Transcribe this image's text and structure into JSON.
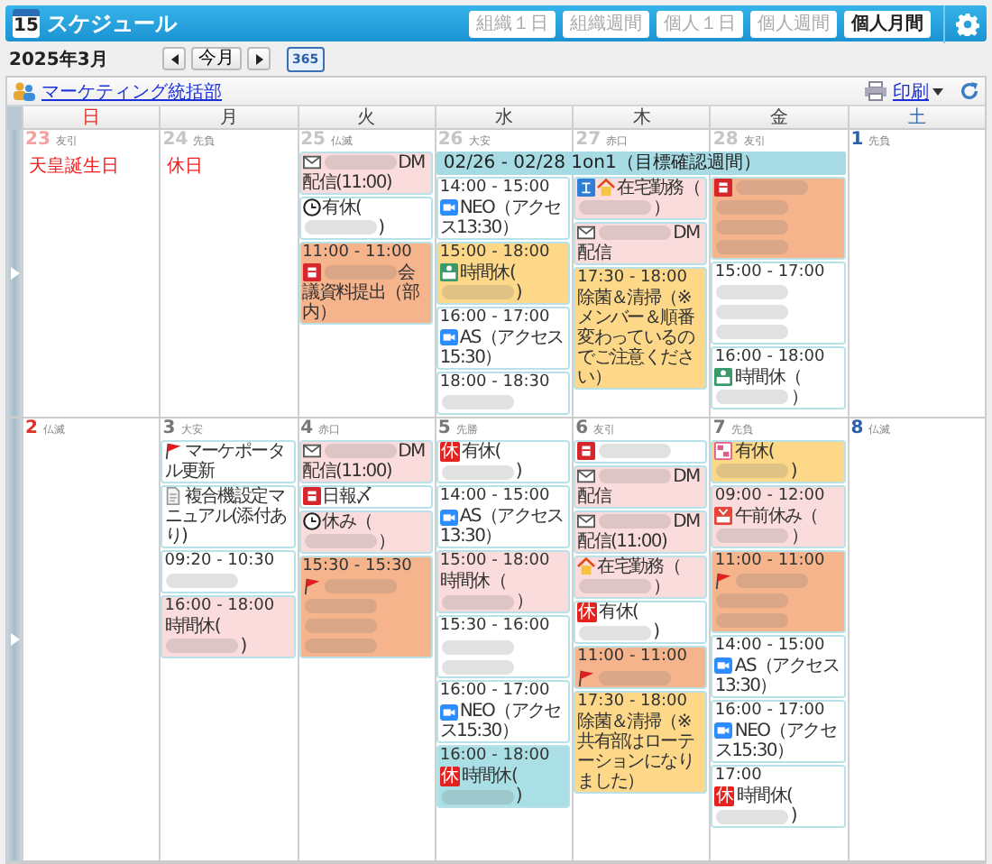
{
  "header": {
    "app_icon_day": "15",
    "title": "スケジュール",
    "views": [
      {
        "label": "組織１日",
        "selected": false
      },
      {
        "label": "組織週間",
        "selected": false
      },
      {
        "label": "個人１日",
        "selected": false
      },
      {
        "label": "個人週間",
        "selected": false
      },
      {
        "label": "個人月間",
        "selected": true
      }
    ]
  },
  "nav": {
    "month": "2025年3月",
    "today": "今月",
    "year_button": "365"
  },
  "group": {
    "name": "マーケティング統括部",
    "print": "印刷"
  },
  "weekdays": [
    {
      "label": "日",
      "kind": "sunday"
    },
    {
      "label": "月",
      "kind": "weekday"
    },
    {
      "label": "火",
      "kind": "weekday"
    },
    {
      "label": "水",
      "kind": "weekday"
    },
    {
      "label": "木",
      "kind": "weekday"
    },
    {
      "label": "金",
      "kind": "weekday"
    },
    {
      "label": "土",
      "kind": "saturday"
    }
  ],
  "weeks": [
    {
      "banner": "02/26 - 02/28 1on1（目標確認週間）",
      "days": [
        {
          "date": "23",
          "rokuyo": "友引",
          "kind": "sunday",
          "muted": true,
          "holiday": "天皇誕生日"
        },
        {
          "date": "24",
          "rokuyo": "先負",
          "kind": "weekday",
          "muted": true,
          "holiday": "休日"
        },
        {
          "date": "25",
          "rokuyo": "仏滅",
          "kind": "weekday",
          "muted": true,
          "events": [
            {
              "kind": "mail",
              "color": "#fbdcdc",
              "parts": [
                {
                  "kind": "blur"
                },
                {
                  "kind": "text",
                  "text": "DM配信(11:00)"
                }
              ]
            },
            {
              "kind": "leave",
              "color": "#ffffff",
              "parts": [
                {
                  "kind": "text",
                  "text": "有休("
                },
                {
                  "kind": "blur"
                },
                {
                  "kind": "text",
                  "text": ")"
                }
              ]
            },
            {
              "kind": "task",
              "color": "#f5b48c",
              "time": "11:00 - 11:00",
              "parts": [
                {
                  "kind": "blur"
                },
                {
                  "kind": "text",
                  "text": "会議資料提出（部内）"
                }
              ]
            }
          ]
        },
        {
          "date": "26",
          "rokuyo": "大安",
          "kind": "weekday",
          "muted": true,
          "in_banner": true,
          "events": [
            {
              "kind": "video",
              "color": "#ffffff",
              "time": "14:00 - 15:00",
              "parts": [
                {
                  "kind": "text",
                  "text": "NEO（アクセス13:30）"
                }
              ]
            },
            {
              "kind": "timecard",
              "color": "#fdd889",
              "time": "15:00 - 18:00",
              "parts": [
                {
                  "kind": "text",
                  "text": "時間休("
                },
                {
                  "kind": "blur"
                },
                {
                  "kind": "text",
                  "text": ")"
                }
              ]
            },
            {
              "kind": "video",
              "color": "#ffffff",
              "time": "16:00 - 17:00",
              "parts": [
                {
                  "kind": "text",
                  "text": "AS（アクセス15:30）"
                }
              ]
            },
            {
              "kind": "plain",
              "color": "#ffffff",
              "time": "18:00 - 18:30",
              "parts": [
                {
                  "kind": "blur"
                }
              ]
            }
          ]
        },
        {
          "date": "27",
          "rokuyo": "赤口",
          "kind": "weekday",
          "muted": true,
          "in_banner": true,
          "events": [
            {
              "kind": "remote",
              "color": "#fbdcdc",
              "parts": [
                {
                  "kind": "text",
                  "text": "在宅勤務（"
                },
                {
                  "kind": "blur"
                },
                {
                  "kind": "text",
                  "text": "）"
                }
              ]
            },
            {
              "kind": "mail",
              "color": "#fbdcdc",
              "parts": [
                {
                  "kind": "blur"
                },
                {
                  "kind": "text",
                  "text": "DM配信"
                }
              ]
            },
            {
              "kind": "plain",
              "color": "#fdd889",
              "time": "17:30 - 18:00",
              "parts": [
                {
                  "kind": "text",
                  "text": "除菌＆清掃（※メンバー＆順番変わっているのでご注意ください）"
                }
              ]
            }
          ]
        },
        {
          "date": "28",
          "rokuyo": "友引",
          "kind": "weekday",
          "muted": true,
          "in_banner": true,
          "events": [
            {
              "kind": "task",
              "color": "#f5b48c",
              "parts": [
                {
                  "kind": "blur"
                },
                {
                  "kind": "blur"
                },
                {
                  "kind": "blur"
                },
                {
                  "kind": "blur"
                }
              ]
            },
            {
              "kind": "plain",
              "color": "#ffffff",
              "time": "15:00 - 17:00",
              "parts": [
                {
                  "kind": "blur"
                },
                {
                  "kind": "blur"
                },
                {
                  "kind": "blur"
                }
              ]
            },
            {
              "kind": "timecard",
              "color": "#ffffff",
              "time": "16:00 - 18:00",
              "parts": [
                {
                  "kind": "text",
                  "text": "時間休（"
                },
                {
                  "kind": "blur"
                },
                {
                  "kind": "text",
                  "text": "）"
                }
              ]
            }
          ]
        },
        {
          "date": "1",
          "rokuyo": "先負",
          "kind": "saturday",
          "muted": false
        }
      ]
    },
    {
      "days": [
        {
          "date": "2",
          "rokuyo": "仏滅",
          "kind": "sunday",
          "muted": false
        },
        {
          "date": "3",
          "rokuyo": "大安",
          "kind": "weekday",
          "muted": false,
          "events": [
            {
              "kind": "flag",
              "color": "#ffffff",
              "parts": [
                {
                  "kind": "text",
                  "text": "マーケポータル更新"
                }
              ]
            },
            {
              "kind": "document",
              "color": "#ffffff",
              "parts": [
                {
                  "kind": "text",
                  "text": "複合機設定マニュアル(添付あり)"
                }
              ]
            },
            {
              "kind": "plain",
              "color": "#ffffff",
              "time": "09:20 - 10:30",
              "parts": [
                {
                  "kind": "blur"
                }
              ]
            },
            {
              "kind": "plain",
              "color": "#fbdcdc",
              "time": "16:00 - 18:00",
              "parts": [
                {
                  "kind": "text",
                  "text": "時間休("
                },
                {
                  "kind": "blur"
                },
                {
                  "kind": "text",
                  "text": ")"
                }
              ]
            }
          ]
        },
        {
          "date": "4",
          "rokuyo": "赤口",
          "kind": "weekday",
          "muted": false,
          "events": [
            {
              "kind": "mail",
              "color": "#fbdcdc",
              "parts": [
                {
                  "kind": "blur"
                },
                {
                  "kind": "text",
                  "text": "DM配信(11:00)"
                }
              ]
            },
            {
              "kind": "task",
              "color": "#ffffff",
              "parts": [
                {
                  "kind": "text",
                  "text": "日報〆"
                }
              ]
            },
            {
              "kind": "leave",
              "color": "#fbdcdc",
              "parts": [
                {
                  "kind": "text",
                  "text": "休み（"
                },
                {
                  "kind": "blur"
                },
                {
                  "kind": "text",
                  "text": "）"
                }
              ]
            },
            {
              "kind": "flag",
              "color": "#f5b48c",
              "time": "15:30 - 15:30",
              "parts": [
                {
                  "kind": "blur"
                },
                {
                  "kind": "blur"
                },
                {
                  "kind": "blur"
                },
                {
                  "kind": "blur"
                }
              ]
            }
          ]
        },
        {
          "date": "5",
          "rokuyo": "先勝",
          "kind": "weekday",
          "muted": false,
          "events": [
            {
              "kind": "plain",
              "color": "#ffffff",
              "badge": "休",
              "parts": [
                {
                  "kind": "text",
                  "text": "有休("
                },
                {
                  "kind": "blur"
                },
                {
                  "kind": "text",
                  "text": ")"
                }
              ]
            },
            {
              "kind": "video",
              "color": "#ffffff",
              "time": "14:00 - 15:00",
              "parts": [
                {
                  "kind": "text",
                  "text": "AS（アクセス13:30）"
                }
              ]
            },
            {
              "kind": "plain",
              "color": "#fbdcdc",
              "time": "15:00 - 18:00",
              "parts": [
                {
                  "kind": "text",
                  "text": "時間休（"
                },
                {
                  "kind": "blur"
                },
                {
                  "kind": "text",
                  "text": "）"
                }
              ]
            },
            {
              "kind": "plain",
              "color": "#ffffff",
              "time": "15:30 - 16:00",
              "parts": [
                {
                  "kind": "blur"
                },
                {
                  "kind": "blur"
                }
              ]
            },
            {
              "kind": "video",
              "color": "#ffffff",
              "time": "16:00 - 17:00",
              "parts": [
                {
                  "kind": "text",
                  "text": "NEO（アクセス15:30）"
                }
              ]
            },
            {
              "kind": "plain",
              "color": "#a9dfe5",
              "time": "16:00 - 18:00",
              "badge": "休",
              "parts": [
                {
                  "kind": "text",
                  "text": "時間休("
                },
                {
                  "kind": "blur"
                },
                {
                  "kind": "text",
                  "text": ")"
                }
              ]
            }
          ]
        },
        {
          "date": "6",
          "rokuyo": "友引",
          "kind": "weekday",
          "muted": false,
          "events": [
            {
              "kind": "task",
              "color": "#ffffff",
              "parts": [
                {
                  "kind": "blur"
                }
              ]
            },
            {
              "kind": "mail",
              "color": "#fbdcdc",
              "parts": [
                {
                  "kind": "blur"
                },
                {
                  "kind": "text",
                  "text": "DM配信"
                }
              ]
            },
            {
              "kind": "mail",
              "color": "#fbdcdc",
              "parts": [
                {
                  "kind": "blur"
                },
                {
                  "kind": "text",
                  "text": "DM配信(11:00)"
                }
              ]
            },
            {
              "kind": "home",
              "color": "#fbdcdc",
              "parts": [
                {
                  "kind": "text",
                  "text": "在宅勤務（"
                },
                {
                  "kind": "blur"
                },
                {
                  "kind": "text",
                  "text": "）"
                }
              ]
            },
            {
              "kind": "plain",
              "color": "#ffffff",
              "badge": "休",
              "parts": [
                {
                  "kind": "text",
                  "text": "有休("
                },
                {
                  "kind": "blur"
                },
                {
                  "kind": "text",
                  "text": ")"
                }
              ]
            },
            {
              "kind": "flag",
              "color": "#f5b48c",
              "time": "11:00 - 11:00",
              "parts": [
                {
                  "kind": "blur"
                }
              ]
            },
            {
              "kind": "plain",
              "color": "#fdd889",
              "time": "17:30 - 18:00",
              "parts": [
                {
                  "kind": "text",
                  "text": "除菌＆清掃（※共有部はローテーションになりました）"
                }
              ]
            }
          ]
        },
        {
          "date": "7",
          "rokuyo": "先負",
          "kind": "weekday",
          "muted": false,
          "events": [
            {
              "kind": "card",
              "color": "#fdd889",
              "parts": [
                {
                  "kind": "text",
                  "text": "有休("
                },
                {
                  "kind": "blur"
                },
                {
                  "kind": "text",
                  "text": ")"
                }
              ]
            },
            {
              "kind": "half-day",
              "color": "#fbdcdc",
              "time": "09:00 - 12:00",
              "parts": [
                {
                  "kind": "text",
                  "text": "午前休み（"
                },
                {
                  "kind": "blur"
                },
                {
                  "kind": "text",
                  "text": "）"
                }
              ]
            },
            {
              "kind": "flag",
              "color": "#f5b48c",
              "time": "11:00 - 11:00",
              "parts": [
                {
                  "kind": "blur"
                },
                {
                  "kind": "blur"
                },
                {
                  "kind": "blur"
                }
              ]
            },
            {
              "kind": "video",
              "color": "#ffffff",
              "time": "14:00 - 15:00",
              "parts": [
                {
                  "kind": "text",
                  "text": "AS（アクセス13:30）"
                }
              ]
            },
            {
              "kind": "video",
              "color": "#ffffff",
              "time": "16:00 - 17:00",
              "parts": [
                {
                  "kind": "text",
                  "text": "NEO（アクセス15:30）"
                }
              ]
            },
            {
              "kind": "plain",
              "color": "#ffffff",
              "time": "17:00",
              "badge": "休",
              "parts": [
                {
                  "kind": "text",
                  "text": "時間休("
                },
                {
                  "kind": "blur"
                },
                {
                  "kind": "text",
                  "text": ")"
                }
              ]
            }
          ]
        },
        {
          "date": "8",
          "rokuyo": "仏滅",
          "kind": "saturday",
          "muted": false
        }
      ]
    }
  ]
}
